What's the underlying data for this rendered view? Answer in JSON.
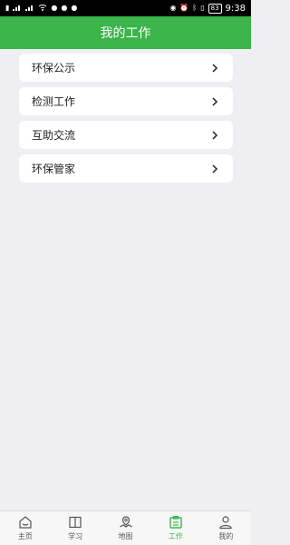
{
  "status_bar": {
    "left_icons": [
      "sim-1-icon",
      "sim-2-icon",
      "signal-icon",
      "signal-icon",
      "wifi-icon",
      "snapchat-icon",
      "message-icon",
      "notification-icon"
    ],
    "right_icons": [
      "eye-icon",
      "alarm-icon",
      "bluetooth-icon",
      "vibrate-icon"
    ],
    "battery": "83",
    "time": "9:38"
  },
  "header": {
    "title": "我的工作",
    "background": "#3bb54a"
  },
  "menu": {
    "items": [
      {
        "label": "环保公示"
      },
      {
        "label": "检测工作"
      },
      {
        "label": "互助交流"
      },
      {
        "label": "环保管家"
      }
    ]
  },
  "tab_bar": {
    "active_color": "#3bb54a",
    "tabs": [
      {
        "label": "主页",
        "icon": "home-icon",
        "active": false
      },
      {
        "label": "学习",
        "icon": "book-icon",
        "active": false
      },
      {
        "label": "地图",
        "icon": "map-icon",
        "active": false
      },
      {
        "label": "工作",
        "icon": "work-icon",
        "active": true
      },
      {
        "label": "我的",
        "icon": "user-icon",
        "active": false
      }
    ]
  }
}
